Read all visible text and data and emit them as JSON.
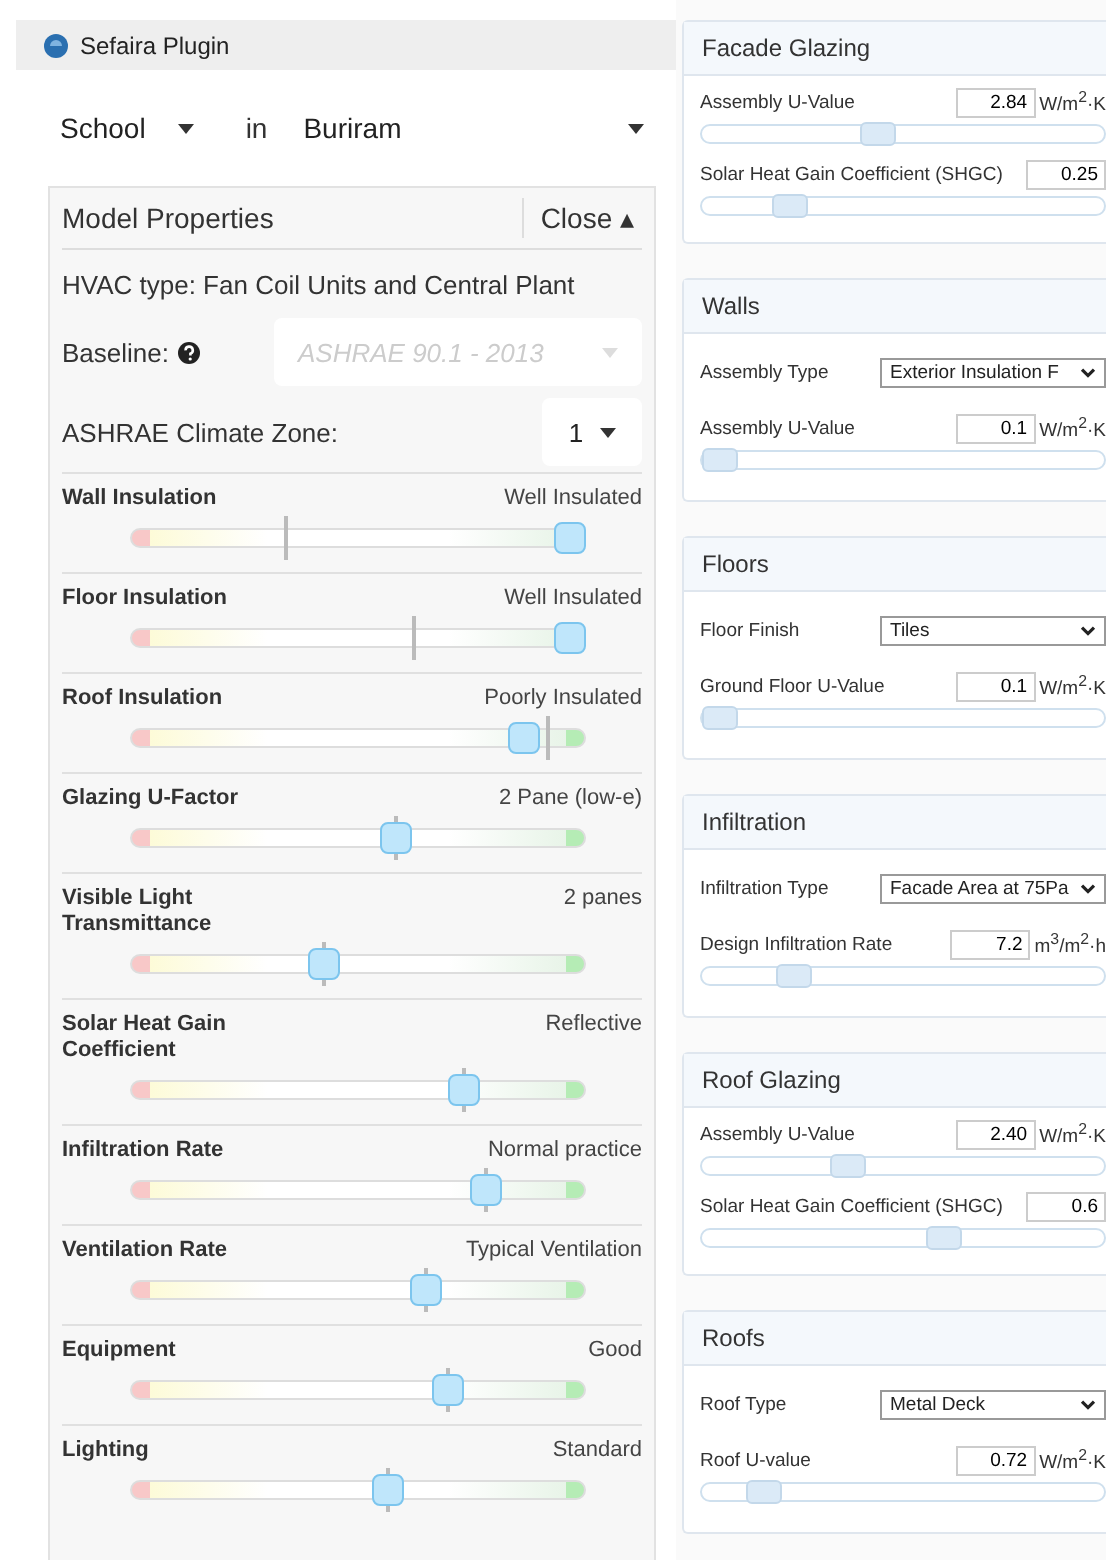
{
  "window": {
    "title": "Sefaira Plugin"
  },
  "context": {
    "building": "School",
    "connector": "in",
    "location": "Buriram"
  },
  "model_properties": {
    "title": "Model Properties",
    "close": "Close ▴",
    "hvac": "HVAC type: Fan Coil Units and Central Plant",
    "baseline_label": "Baseline:",
    "baseline_value": "ASHRAE 90.1 - 2013",
    "climate_label": "ASHRAE Climate Zone:",
    "climate_value": "1",
    "sliders": [
      {
        "label": "Wall Insulation",
        "value": "Well Insulated",
        "level": 1.0,
        "baseline": {
          "level": 0.33
        }
      },
      {
        "label": "Floor Insulation",
        "value": "Well Insulated",
        "level": 1.0,
        "baseline": {
          "level": 0.63
        }
      },
      {
        "label": "Roof Insulation",
        "value": "Poorly Insulated",
        "level": 0.89,
        "baseline": {
          "level": 0.95
        }
      },
      {
        "label": "Glazing U-Factor",
        "value": "2 Pane (low-e)",
        "level": 0.59,
        "baseline": {
          "level": 0.59
        }
      },
      {
        "label": "Visible Light Transmittance",
        "value": "2 panes",
        "level": 0.42,
        "baseline": {
          "level": 0.42
        }
      },
      {
        "label": "Solar Heat Gain Coefficient",
        "value": "Reflective",
        "level": 0.75,
        "baseline": {
          "level": 0.75
        }
      },
      {
        "label": "Infiltration Rate",
        "value": "Normal practice",
        "level": 0.8,
        "baseline": {
          "level": 0.8
        }
      },
      {
        "label": "Ventilation Rate",
        "value": "Typical Ventilation",
        "level": 0.66,
        "baseline": {
          "level": 0.66
        }
      },
      {
        "label": "Equipment",
        "value": "Good",
        "level": 0.71,
        "baseline": {
          "level": 0.71
        }
      },
      {
        "label": "Lighting",
        "value": "Standard",
        "level": 0.57,
        "baseline": {
          "level": 0.57
        }
      }
    ]
  },
  "sections": [
    {
      "title": "Facade Glazing",
      "fields": [
        {
          "kind": "number",
          "label": "Assembly U-Value",
          "value": "2.84",
          "unit": "W/m$^{2}$·K",
          "level": 0.43
        },
        {
          "kind": "number",
          "label": "Solar Heat Gain Coefficient (SHGC)",
          "value": "0.25",
          "level": 0.19
        }
      ]
    },
    {
      "title": "Walls",
      "fields": [
        {
          "kind": "select",
          "label": "Assembly Type",
          "value": "Exterior Insulation F"
        },
        {
          "kind": "number",
          "label": "Assembly U-Value",
          "value": "0.1",
          "unit": "W/m$^{2}$·K",
          "level": 0.0
        }
      ]
    },
    {
      "title": "Floors",
      "fields": [
        {
          "kind": "select",
          "label": "Floor Finish",
          "value": "Tiles"
        },
        {
          "kind": "number",
          "label": "Ground Floor U-Value",
          "value": "0.1",
          "unit": "W/m$^{2}$·K",
          "level": 0.0
        }
      ]
    },
    {
      "title": "Infiltration",
      "fields": [
        {
          "kind": "select",
          "label": "Infiltration Type",
          "value": "Facade Area at 75Pa"
        },
        {
          "kind": "number",
          "label": "Design Infiltration Rate",
          "value": "7.2",
          "unit": "m$^{3}$/m$^{2}$·h",
          "level": 0.2
        }
      ]
    },
    {
      "title": "Roof Glazing",
      "fields": [
        {
          "kind": "number",
          "label": "Assembly U-Value",
          "value": "2.40",
          "unit": "W/m$^{2}$·K",
          "level": 0.35
        },
        {
          "kind": "number",
          "label": "Solar Heat Gain Coefficient (SHGC)",
          "value": "0.6",
          "level": 0.61
        }
      ]
    },
    {
      "title": "Roofs",
      "fields": [
        {
          "kind": "select",
          "label": "Roof Type",
          "value": "Metal Deck"
        },
        {
          "kind": "number",
          "label": "Roof U-value",
          "value": "0.72",
          "unit": "W/m$^{2}$·K",
          "level": 0.12
        }
      ]
    }
  ]
}
